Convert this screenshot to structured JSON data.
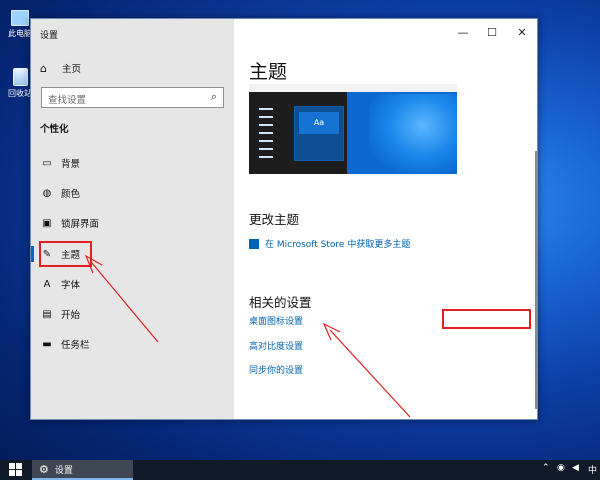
{
  "desktop": {
    "icons": [
      {
        "label": "此电脑",
        "icon": "computer-icon"
      },
      {
        "label": "回收站",
        "icon": "recycle-bin-icon"
      }
    ]
  },
  "window": {
    "title": "设置",
    "controls": {
      "minimize": "—",
      "maximize": "☐",
      "close": "✕"
    }
  },
  "sidebar": {
    "home_label": "主页",
    "search_placeholder": "查找设置",
    "section_title": "个性化",
    "items": [
      {
        "label": "背景",
        "icon": "picture-icon"
      },
      {
        "label": "颜色",
        "icon": "palette-icon"
      },
      {
        "label": "锁屏界面",
        "icon": "lock-screen-icon"
      },
      {
        "label": "主题",
        "icon": "brush-icon",
        "selected": true
      },
      {
        "label": "字体",
        "icon": "font-icon"
      },
      {
        "label": "开始",
        "icon": "start-menu-icon"
      },
      {
        "label": "任务栏",
        "icon": "taskbar-icon"
      }
    ]
  },
  "main": {
    "heading": "主题",
    "preview_sample_text": "Aa",
    "change_theme_heading": "更改主题",
    "store_link": "在 Microsoft Store 中获取更多主题",
    "related_heading": "相关的设置",
    "related_links": [
      "桌面图标设置",
      "高对比度设置",
      "同步你的设置"
    ]
  },
  "taskbar": {
    "app_label": "设置",
    "ime": "中"
  },
  "colors": {
    "accent": "#0063b1",
    "annotation": "#e32020",
    "sidebar_bg": "#e6e6e6",
    "taskbar_bg": "#101a28"
  }
}
